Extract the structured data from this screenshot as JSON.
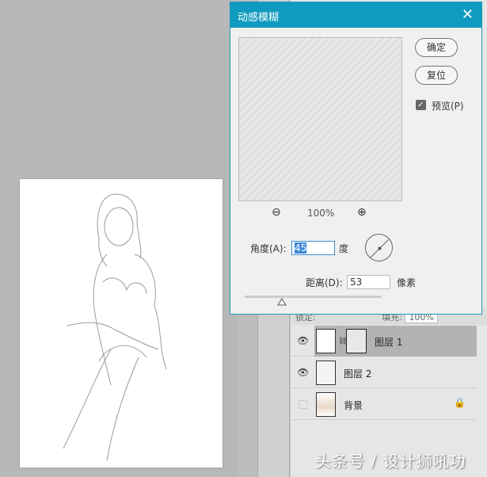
{
  "dialog": {
    "title": "动感模糊",
    "ok": "确定",
    "reset": "复位",
    "preview_label": "预览(P)",
    "preview_checked": true,
    "zoom": "100%",
    "angle_label": "角度(A):",
    "angle_value": "45",
    "angle_unit": "度",
    "distance_label": "距离(D):",
    "distance_value": "53",
    "distance_unit": "像素"
  },
  "layers_panel": {
    "lock_label": "锁定:",
    "fill_label": "填充:",
    "fill_value": "100%",
    "layers": [
      {
        "name": "图层 1",
        "visible": true,
        "selected": true
      },
      {
        "name": "图层 2",
        "visible": true,
        "selected": false
      },
      {
        "name": "背景",
        "visible": false,
        "selected": false,
        "locked": true
      }
    ]
  },
  "watermark": "头条号 / 设计狮吼功",
  "colors": {
    "title_bar": "#0f9bbf",
    "selection": "#3f88d8"
  }
}
